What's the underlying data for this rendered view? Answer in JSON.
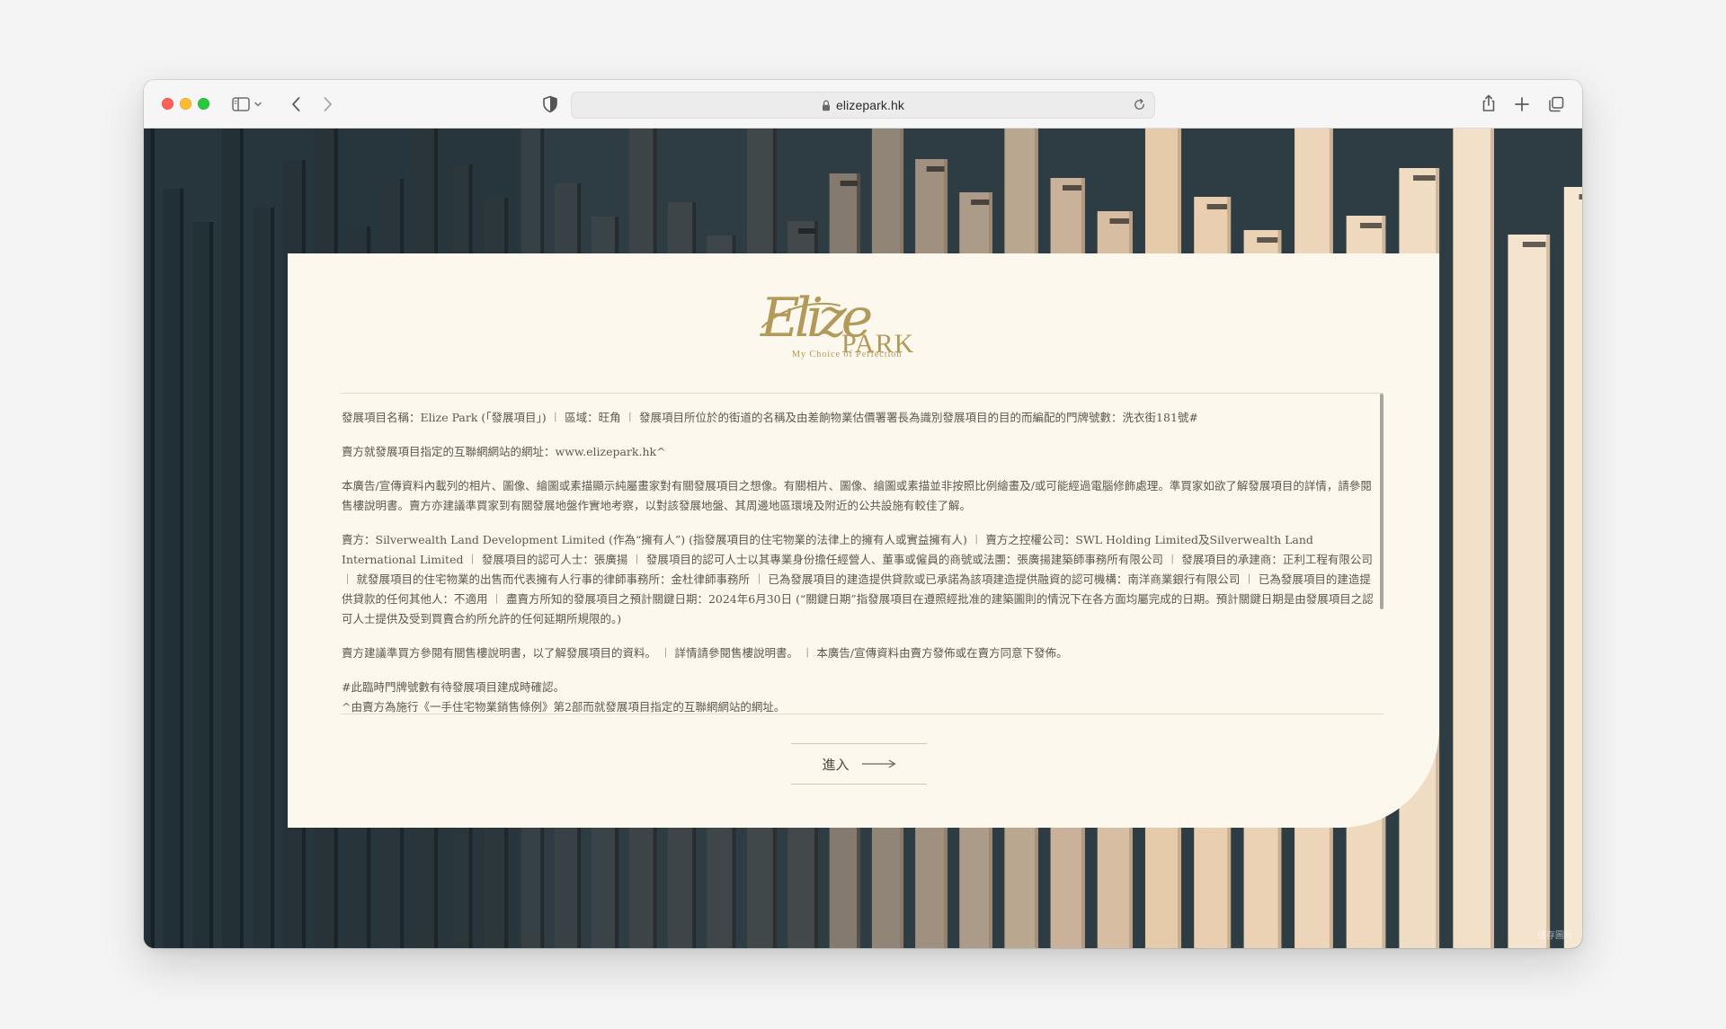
{
  "browser": {
    "url": "elizepark.hk",
    "colors": {
      "close": "#ff5f57",
      "minimize": "#febc2e",
      "zoom": "#28c840"
    }
  },
  "icons": {
    "sidebar": "sidebar-icon",
    "back": "chevron-left-icon",
    "forward": "chevron-right-icon",
    "privacy": "shield-icon",
    "lock": "lock-icon",
    "reload": "reload-icon",
    "share": "share-icon",
    "new_tab": "plus-icon",
    "tabs": "tab-overview-icon"
  },
  "brand": {
    "logo_script": "Elize",
    "logo_word": "PARK",
    "tagline": "My Choice of Perfection",
    "gold": "#b29a5a",
    "card_bg": "#fdf8ee"
  },
  "disclaimer": {
    "paragraphs": [
      "發展項目名稱：Elize Park (「發展項目」) ︱ 區域：旺角 ︱ 發展項目所位於的街道的名稱及由差餉物業估價署署長為識別發展項目的目的而編配的門牌號數：洗衣街181號#",
      "賣方就發展項目指定的互聯網網站的網址：www.elizepark.hk^",
      "本廣告/宣傳資料內載列的相片、圖像、繪圖或素描顯示純屬畫家對有關發展項目之想像。有關相片、圖像、繪圖或素描並非按照比例繪畫及/或可能經過電腦修飾處理。準買家如欲了解發展項目的詳情，請參閱售樓說明書。賣方亦建議準買家到有關發展地盤作實地考察，以對該發展地盤、其周邊地區環境及附近的公共設施有較佳了解。",
      "賣方：Silverwealth Land Development Limited (作為“擁有人”) (指發展項目的住宅物業的法律上的擁有人或實益擁有人) ︱ 賣方之控權公司：SWL Holding Limited及Silverwealth Land International Limited ︱ 發展項目的認可人士：張廣揚 ︱ 發展項目的認可人士以其專業身份擔任經營人、董事或僱員的商號或法團：張廣揚建築師事務所有限公司 ︱ 發展項目的承建商：正利工程有限公司 ︱ 就發展項目的住宅物業的出售而代表擁有人行事的律師事務所：金杜律師事務所 ︱ 已為發展項目的建造提供貸款或已承諾為該項建造提供融資的認可機構：南洋商業銀行有限公司 ︱ 已為發展項目的建造提供貸款的任何其他人：不適用 ︱ 盡賣方所知的發展項目之預計關鍵日期：2024年6月30日 (“關鍵日期”指發展項目在遵照經批准的建築圖則的情況下在各方面均屬完成的日期。預計關鍵日期是由發展項目之認可人士提供及受到買賣合約所允許的任何延期所規限的。)",
      "賣方建議準買方參閱有關售樓說明書，以了解發展項目的資料。 ︱ 詳情請參閱售樓說明書。 ︱ 本廣告/宣傳資料由賣方發佈或在賣方同意下發佈。",
      "#此臨時門牌號數有待發展項目建成時確認。",
      "^由賣方為施行《一手住宅物業銷售條例》第2部而就發展項目指定的互聯網網站的網址。"
    ]
  },
  "enter_button": {
    "label": "進入",
    "arrow_icon": "arrow-right-icon"
  },
  "watermark": "儲存圖片"
}
